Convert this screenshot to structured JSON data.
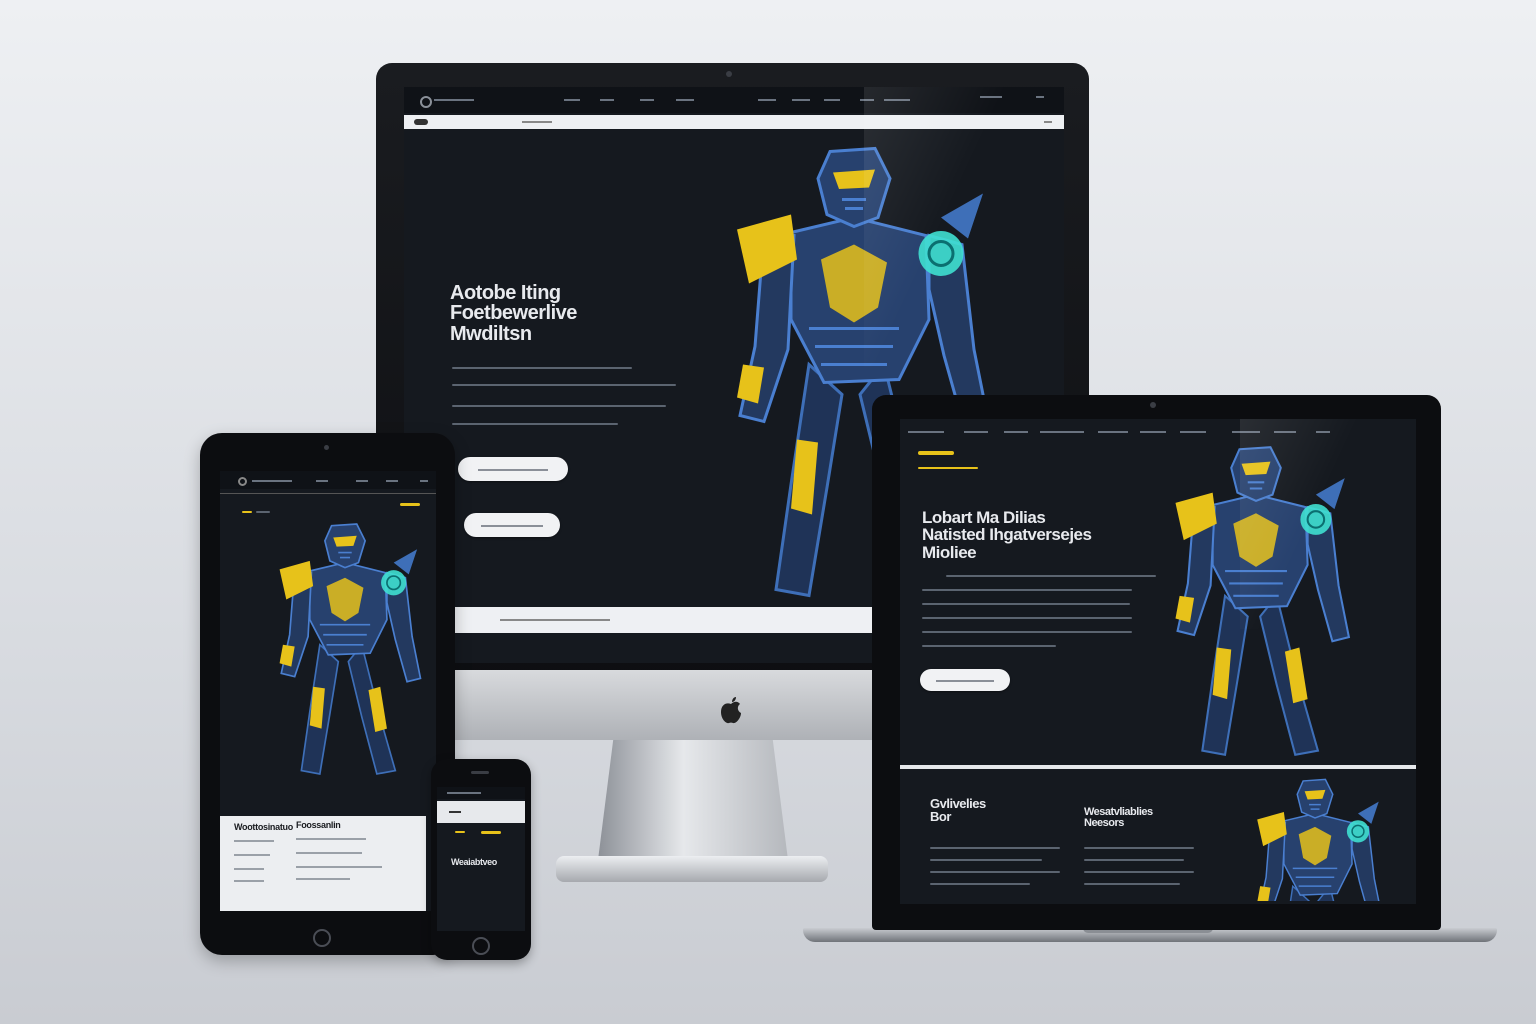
{
  "colors": {
    "accent": "#e7c21a",
    "glow": "#3fe0d0",
    "screen_bg": "#15191f",
    "armor": "#27416e"
  },
  "monitor": {
    "headline": "Aotobe Iting\nFoetbewerlive\nMwdiltsn",
    "brand_icon": "apple-logo-icon"
  },
  "laptop": {
    "headline": "Lobart Ma Dilias\nNatisted Ihgatversejes\nMioliee",
    "section1_title": "Gvlivelies\nBor",
    "section2_title": "Wesatvliablies\nNeesors"
  },
  "tablet": {
    "col1_title": "Woottosinatuo",
    "col2_title": "Foossanlin"
  },
  "phone": {
    "title": "Weaiabtveo"
  }
}
